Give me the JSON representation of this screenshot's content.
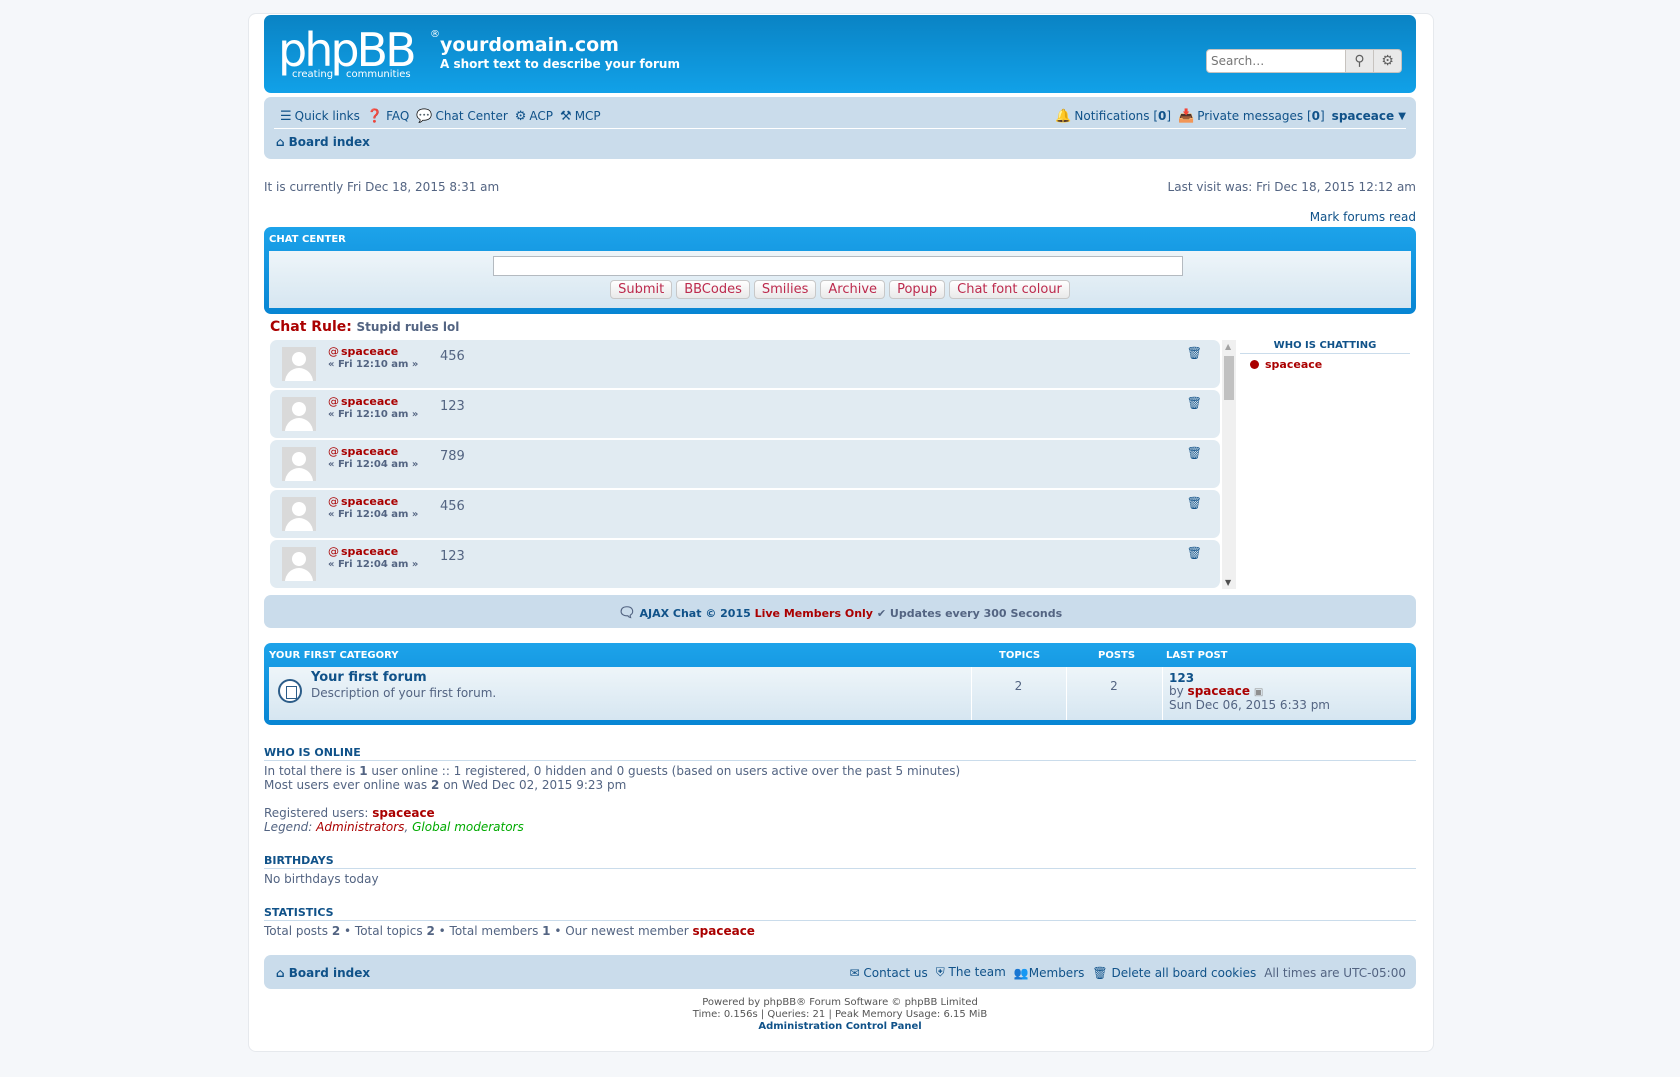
{
  "header": {
    "logo_text": "phpBB",
    "logo_reg": "®",
    "logo_tag1": "creating",
    "logo_tag2": "communities",
    "site_name": "yourdomain.com",
    "site_desc": "A short text to describe your forum",
    "search_placeholder": "Search…"
  },
  "nav": {
    "quick_links": "Quick links",
    "faq": "FAQ",
    "chat_center": "Chat Center",
    "acp": "ACP",
    "mcp": "MCP",
    "notifications": "Notifications",
    "notifications_count": "0",
    "private_messages": "Private messages",
    "pm_count": "0",
    "username": "spaceace",
    "board_index": "Board index"
  },
  "status": {
    "current_time": "It is currently Fri Dec 18, 2015 8:31 am",
    "last_visit": "Last visit was: Fri Dec 18, 2015 12:12 am",
    "mark_read": "Mark forums read"
  },
  "chat": {
    "title": "CHAT CENTER",
    "buttons": [
      "Submit",
      "BBCodes",
      "Smilies",
      "Archive",
      "Popup",
      "Chat font colour"
    ],
    "rule_label": "Chat Rule:",
    "rule_text": "Stupid rules lol",
    "messages": [
      {
        "user": "spaceace",
        "time": "« Fri 12:10 am »",
        "text": "456"
      },
      {
        "user": "spaceace",
        "time": "« Fri 12:10 am »",
        "text": "123"
      },
      {
        "user": "spaceace",
        "time": "« Fri 12:04 am »",
        "text": "789"
      },
      {
        "user": "spaceace",
        "time": "« Fri 12:04 am »",
        "text": "456"
      },
      {
        "user": "spaceace",
        "time": "« Fri 12:04 am »",
        "text": "123"
      }
    ],
    "who_title": "WHO IS CHATTING",
    "who_user": "spaceace",
    "footer_ajax": "AJAX Chat © 2015",
    "footer_live": "Live Members Only",
    "footer_updates": "Updates every",
    "footer_seconds_value": "300",
    "footer_seconds": "Seconds"
  },
  "forum": {
    "category": "YOUR FIRST CATEGORY",
    "col_topics": "TOPICS",
    "col_posts": "POSTS",
    "col_last": "LAST POST",
    "name": "Your first forum",
    "desc": "Description of your first forum.",
    "topics": "2",
    "posts": "2",
    "last_title": "123",
    "last_by": "by",
    "last_user": "spaceace",
    "last_date": "Sun Dec 06, 2015 6:33 pm"
  },
  "online": {
    "title": "WHO IS ONLINE",
    "line1_pre": "In total there is",
    "line1_num": "1",
    "line1_post": "user online :: 1 registered, 0 hidden and 0 guests (based on users active over the past 5 minutes)",
    "line2_pre": "Most users ever online was",
    "line2_num": "2",
    "line2_post": "on Wed Dec 02, 2015 9:23 pm",
    "reg_label": "Registered users:",
    "reg_user": "spaceace",
    "legend_label": "Legend:",
    "legend_admin": "Administrators",
    "legend_comma": ",",
    "legend_gmod": "Global moderators"
  },
  "birthdays": {
    "title": "BIRTHDAYS",
    "text": "No birthdays today"
  },
  "statistics": {
    "title": "STATISTICS",
    "t1": "Total posts",
    "v1": "2",
    "t2": "• Total topics",
    "v2": "2",
    "t3": "• Total members",
    "v3": "1",
    "t4": "• Our newest member",
    "newest": "spaceace"
  },
  "footer": {
    "board_index": "Board index",
    "contact": "Contact us",
    "team": "The team",
    "members": "Members",
    "delete_cookies": "Delete all board cookies",
    "timezone": "All times are UTC-05:00",
    "powered": "Powered by phpBB® Forum Software © phpBB Limited",
    "time_info": "Time: 0.156s | Queries: 21 | Peak Memory Usage: 6.15 MiB",
    "acp_link": "Administration Control Panel"
  }
}
